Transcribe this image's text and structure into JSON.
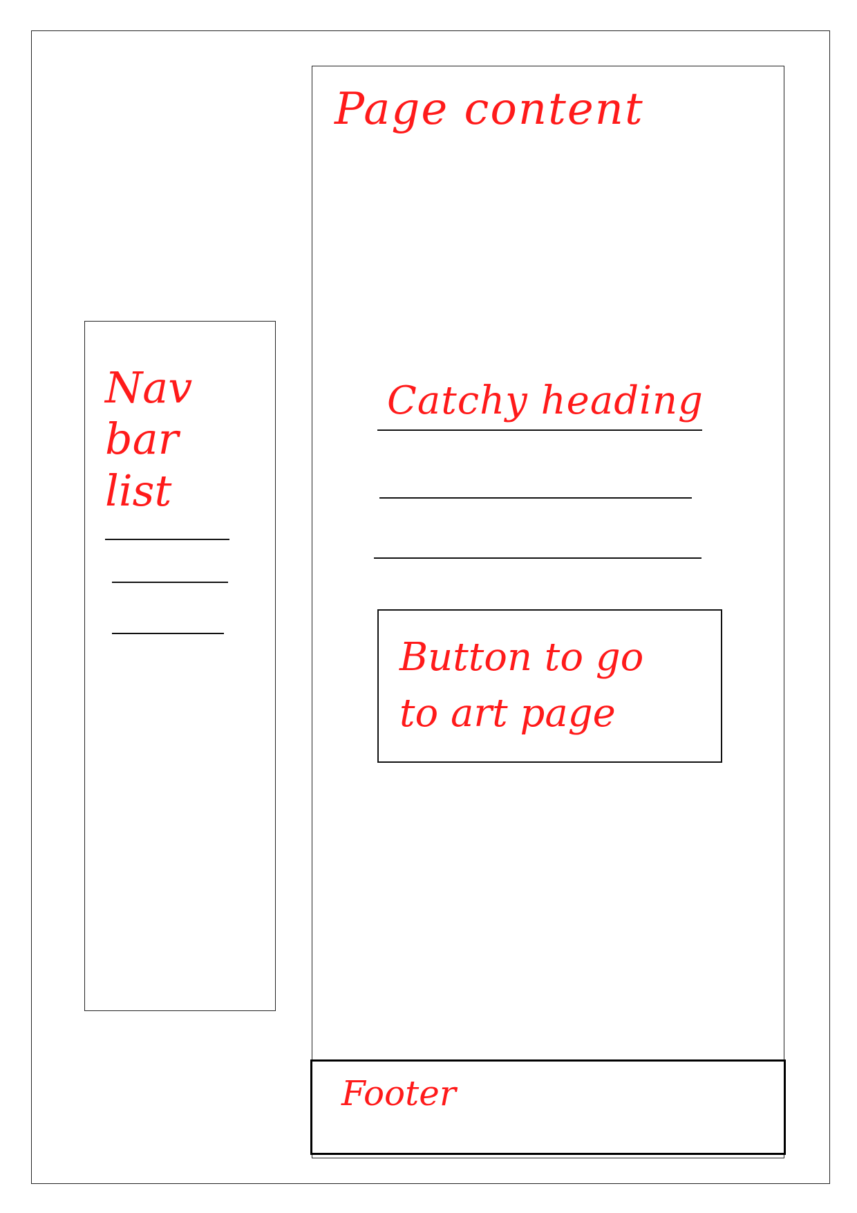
{
  "page": {
    "title": "Page content"
  },
  "navbar": {
    "label": "Nav bar\nlist",
    "items": [
      "",
      "",
      ""
    ]
  },
  "main": {
    "heading": "Catchy heading",
    "text_lines": [
      "",
      "",
      ""
    ],
    "button_label": "Button to go\nto art page"
  },
  "footer": {
    "label": "Footer"
  },
  "colors": {
    "annotation": "#ff1a1a",
    "lines": "#111111",
    "background": "#ffffff"
  }
}
